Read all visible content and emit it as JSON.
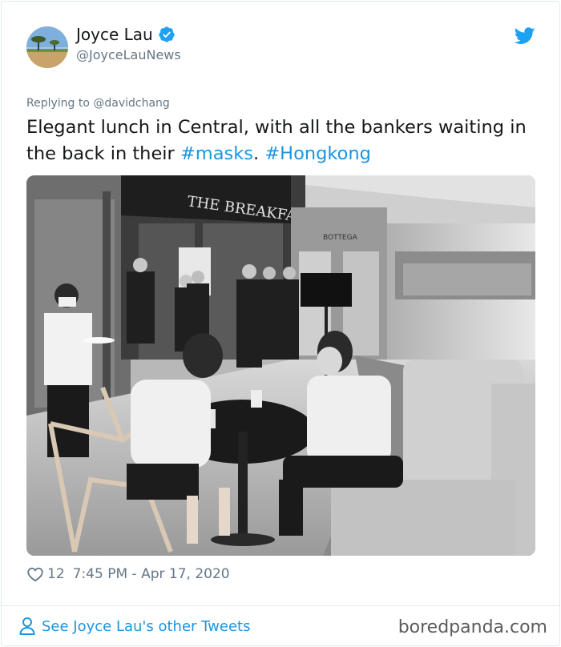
{
  "user": {
    "name": "Joyce Lau",
    "handle": "@JoyceLauNews",
    "avatar_icon": "avatar-beach-tree",
    "verified_icon": "verified-badge-icon"
  },
  "brand_icon": "twitter-bird-icon",
  "replying_to": "Replying to @davidchang",
  "tweet": {
    "text_part1": "Elegant lunch in Central, with all the bankers waiting in the back in their ",
    "hashtag1": "#masks",
    "text_part2": ". ",
    "hashtag2": "#Hongkong"
  },
  "photo": {
    "sign_text": "THE BREAKFAST CLUB",
    "store_sign": "BOTTEGA"
  },
  "meta": {
    "likes": "12",
    "timestamp": "7:45 PM - Apr 17, 2020"
  },
  "footer": {
    "see_more": "See Joyce Lau's other Tweets",
    "watermark": "boredpanda.com"
  },
  "colors": {
    "link": "#1b95e0",
    "text": "#14171a",
    "muted": "#657786",
    "border": "#e1e8ed"
  }
}
